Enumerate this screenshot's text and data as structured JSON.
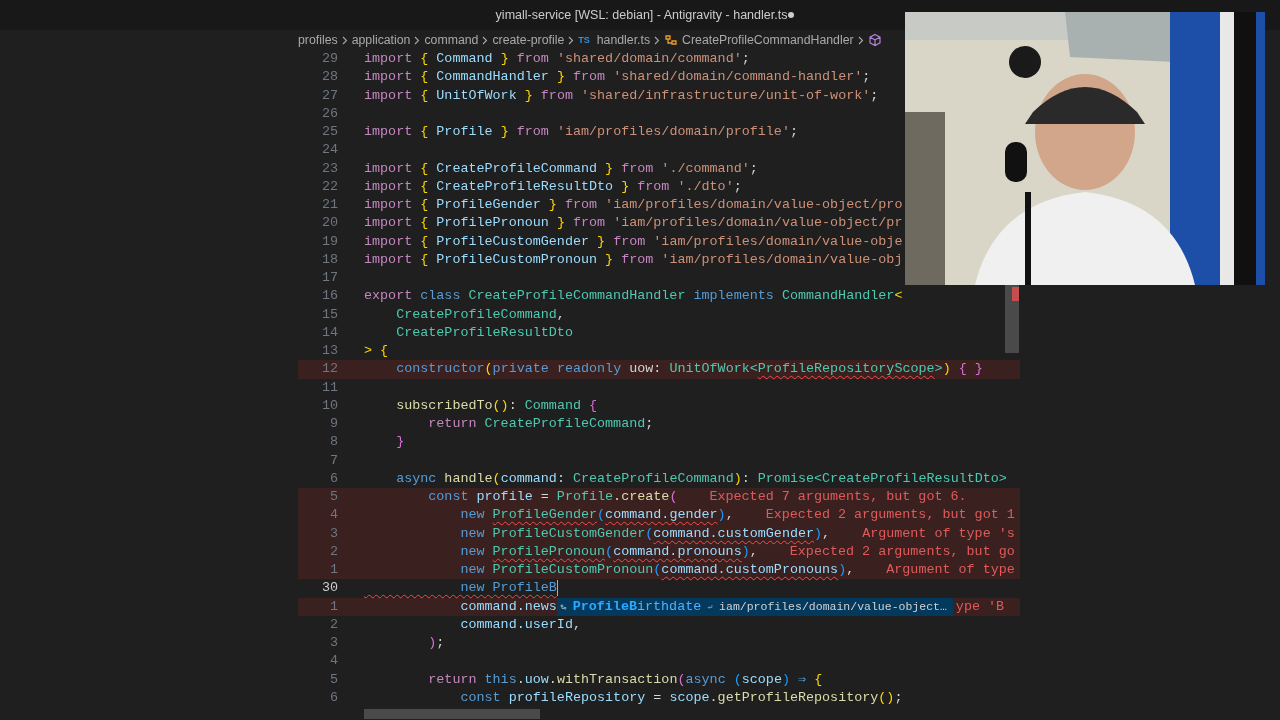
{
  "window": {
    "title": "yimall-service [WSL: debian] - Antigravity - handler.ts",
    "modified": true
  },
  "breadcrumb": [
    {
      "kind": "folder",
      "text": "profiles"
    },
    {
      "kind": "folder",
      "text": "application"
    },
    {
      "kind": "folder",
      "text": "command"
    },
    {
      "kind": "folder",
      "text": "create-profile"
    },
    {
      "kind": "file",
      "badge": "TS",
      "text": "handler.ts"
    },
    {
      "kind": "class",
      "text": "CreateProfileCommandHandler"
    },
    {
      "kind": "symbol"
    }
  ],
  "lines": [
    {
      "number": "29",
      "tokens": [
        {
          "kind": "keyword",
          "text": "import "
        },
        {
          "kind": "brace",
          "text": "{"
        },
        {
          "kind": "variable",
          "text": " Command "
        },
        {
          "kind": "brace",
          "text": "}"
        },
        {
          "kind": "keyword",
          "text": " from "
        },
        {
          "kind": "string",
          "text": "'shared/domain/command'"
        },
        {
          "kind": "plain",
          "text": ";"
        }
      ]
    },
    {
      "number": "28",
      "tokens": [
        {
          "kind": "keyword",
          "text": "import "
        },
        {
          "kind": "brace",
          "text": "{"
        },
        {
          "kind": "variable",
          "text": " CommandHandler "
        },
        {
          "kind": "brace",
          "text": "}"
        },
        {
          "kind": "keyword",
          "text": " from "
        },
        {
          "kind": "string",
          "text": "'shared/domain/command-handler'"
        },
        {
          "kind": "plain",
          "text": ";"
        }
      ]
    },
    {
      "number": "27",
      "tokens": [
        {
          "kind": "keyword",
          "text": "import "
        },
        {
          "kind": "brace",
          "text": "{"
        },
        {
          "kind": "variable",
          "text": " UnitOfWork "
        },
        {
          "kind": "brace",
          "text": "}"
        },
        {
          "kind": "keyword",
          "text": " from "
        },
        {
          "kind": "string",
          "text": "'shared/infrastructure/unit-of-work'"
        },
        {
          "kind": "plain",
          "text": ";"
        }
      ]
    },
    {
      "number": "26"
    },
    {
      "number": "25",
      "tokens": [
        {
          "kind": "keyword",
          "text": "import "
        },
        {
          "kind": "brace",
          "text": "{"
        },
        {
          "kind": "variable",
          "text": " Profile "
        },
        {
          "kind": "brace",
          "text": "}"
        },
        {
          "kind": "keyword",
          "text": " from "
        },
        {
          "kind": "string",
          "text": "'iam/profiles/domain/profile'"
        },
        {
          "kind": "plain",
          "text": ";"
        }
      ]
    },
    {
      "number": "24"
    },
    {
      "number": "23",
      "tokens": [
        {
          "kind": "keyword",
          "text": "import "
        },
        {
          "kind": "brace",
          "text": "{"
        },
        {
          "kind": "variable",
          "text": " CreateProfileCommand "
        },
        {
          "kind": "brace",
          "text": "}"
        },
        {
          "kind": "keyword",
          "text": " from "
        },
        {
          "kind": "string",
          "text": "'./command'"
        },
        {
          "kind": "plain",
          "text": ";"
        }
      ]
    },
    {
      "number": "22",
      "tokens": [
        {
          "kind": "keyword",
          "text": "import "
        },
        {
          "kind": "brace",
          "text": "{"
        },
        {
          "kind": "variable",
          "text": " CreateProfileResultDto "
        },
        {
          "kind": "brace",
          "text": "}"
        },
        {
          "kind": "keyword",
          "text": " from "
        },
        {
          "kind": "string",
          "text": "'./dto'"
        },
        {
          "kind": "plain",
          "text": ";"
        }
      ]
    },
    {
      "number": "21",
      "tokens": [
        {
          "kind": "keyword",
          "text": "import "
        },
        {
          "kind": "brace",
          "text": "{"
        },
        {
          "kind": "variable",
          "text": " ProfileGender "
        },
        {
          "kind": "brace",
          "text": "}"
        },
        {
          "kind": "keyword",
          "text": " from "
        },
        {
          "kind": "string",
          "text": "'iam/profiles/domain/value-object/pro"
        }
      ]
    },
    {
      "number": "20",
      "tokens": [
        {
          "kind": "keyword",
          "text": "import "
        },
        {
          "kind": "brace",
          "text": "{"
        },
        {
          "kind": "variable",
          "text": " ProfilePronoun "
        },
        {
          "kind": "brace",
          "text": "}"
        },
        {
          "kind": "keyword",
          "text": " from "
        },
        {
          "kind": "string",
          "text": "'iam/profiles/domain/value-object/pr"
        }
      ]
    },
    {
      "number": "19",
      "tokens": [
        {
          "kind": "keyword",
          "text": "import "
        },
        {
          "kind": "brace",
          "text": "{"
        },
        {
          "kind": "variable",
          "text": " ProfileCustomGender "
        },
        {
          "kind": "brace",
          "text": "}"
        },
        {
          "kind": "keyword",
          "text": " from "
        },
        {
          "kind": "string",
          "text": "'iam/profiles/domain/value-obje"
        }
      ]
    },
    {
      "number": "18",
      "tokens": [
        {
          "kind": "keyword",
          "text": "import "
        },
        {
          "kind": "brace",
          "text": "{"
        },
        {
          "kind": "variable",
          "text": " ProfileCustomPronoun "
        },
        {
          "kind": "brace",
          "text": "}"
        },
        {
          "kind": "keyword",
          "text": " from "
        },
        {
          "kind": "string",
          "text": "'iam/profiles/domain/value-obj"
        }
      ]
    },
    {
      "number": "17"
    },
    {
      "number": "16",
      "tokens": [
        {
          "kind": "keyword",
          "text": "export "
        },
        {
          "kind": "storage",
          "text": "class "
        },
        {
          "kind": "type",
          "text": "CreateProfileCommandHandler "
        },
        {
          "kind": "storage",
          "text": "implements "
        },
        {
          "kind": "type",
          "text": "CommandHandler"
        },
        {
          "kind": "brace",
          "text": "<"
        }
      ]
    },
    {
      "number": "15",
      "tokens": [
        {
          "kind": "type",
          "text": "    CreateProfileCommand"
        },
        {
          "kind": "plain",
          "text": ","
        }
      ]
    },
    {
      "number": "14",
      "tokens": [
        {
          "kind": "type",
          "text": "    CreateProfileResultDto"
        }
      ]
    },
    {
      "number": "13",
      "tokens": [
        {
          "kind": "brace",
          "text": "> {"
        }
      ]
    },
    {
      "number": "12",
      "error_line": true,
      "tokens": [
        {
          "kind": "storage",
          "text": "    constructor"
        },
        {
          "kind": "brace",
          "text": "("
        },
        {
          "kind": "storage",
          "text": "private readonly "
        },
        {
          "kind": "plain",
          "text": "uow: "
        },
        {
          "kind": "type",
          "text": "UnitOfWork<"
        },
        {
          "kind": "type",
          "text": "ProfileRepositoryScope",
          "squiggle": true
        },
        {
          "kind": "type",
          "text": ">"
        },
        {
          "kind": "brace",
          "text": ")"
        },
        {
          "kind": "bracket",
          "text": " { }"
        }
      ]
    },
    {
      "number": "11"
    },
    {
      "number": "10",
      "tokens": [
        {
          "kind": "function",
          "text": "    subscribedTo"
        },
        {
          "kind": "brace",
          "text": "()"
        },
        {
          "kind": "plain",
          "text": ": "
        },
        {
          "kind": "type",
          "text": "Command "
        },
        {
          "kind": "bracket",
          "text": "{"
        }
      ]
    },
    {
      "number": "9",
      "tokens": [
        {
          "kind": "keyword",
          "text": "        return "
        },
        {
          "kind": "type",
          "text": "CreateProfileCommand"
        },
        {
          "kind": "plain",
          "text": ";"
        }
      ]
    },
    {
      "number": "8",
      "tokens": [
        {
          "kind": "bracket",
          "text": "    }"
        }
      ]
    },
    {
      "number": "7"
    },
    {
      "number": "6",
      "tokens": [
        {
          "kind": "storage",
          "text": "    async "
        },
        {
          "kind": "function",
          "text": "handle"
        },
        {
          "kind": "brace",
          "text": "("
        },
        {
          "kind": "variable",
          "text": "command"
        },
        {
          "kind": "plain",
          "text": ": "
        },
        {
          "kind": "type",
          "text": "CreateProfileCommand"
        },
        {
          "kind": "brace",
          "text": ")"
        },
        {
          "kind": "plain",
          "text": ": "
        },
        {
          "kind": "type",
          "text": "Promise<CreateProfileResultDto>"
        }
      ]
    },
    {
      "number": "5",
      "error_line": true,
      "error": "Expected 7 arguments, but got 6.",
      "tokens": [
        {
          "kind": "storage",
          "text": "        const "
        },
        {
          "kind": "variable",
          "text": "profile"
        },
        {
          "kind": "plain",
          "text": " = "
        },
        {
          "kind": "type",
          "text": "Profile"
        },
        {
          "kind": "plain",
          "text": "."
        },
        {
          "kind": "function",
          "text": "create"
        },
        {
          "kind": "bracket",
          "text": "("
        }
      ]
    },
    {
      "number": "4",
      "error_line": true,
      "error": "Expected 2 arguments, but got 1",
      "tokens": [
        {
          "kind": "storage",
          "text": "            new "
        },
        {
          "kind": "type",
          "text": "ProfileGender",
          "squiggle": true
        },
        {
          "kind": "link",
          "text": "("
        },
        {
          "kind": "variable",
          "text": "command.gender",
          "squiggle": true
        },
        {
          "kind": "link",
          "text": ")"
        },
        {
          "kind": "plain",
          "text": ","
        }
      ]
    },
    {
      "number": "3",
      "error_line": true,
      "error": "Argument of type 's",
      "tokens": [
        {
          "kind": "storage",
          "text": "            new "
        },
        {
          "kind": "type",
          "text": "ProfileCustomGender"
        },
        {
          "kind": "link",
          "text": "("
        },
        {
          "kind": "variable",
          "text": "command.customGender",
          "squiggle": true
        },
        {
          "kind": "link",
          "text": ")"
        },
        {
          "kind": "plain",
          "text": ","
        }
      ]
    },
    {
      "number": "2",
      "error_line": true,
      "error": "Expected 2 arguments, but go",
      "tokens": [
        {
          "kind": "storage",
          "text": "            new "
        },
        {
          "kind": "type",
          "text": "ProfilePronoun",
          "squiggle": true
        },
        {
          "kind": "link",
          "text": "("
        },
        {
          "kind": "variable",
          "text": "command.pronouns",
          "squiggle": true
        },
        {
          "kind": "link",
          "text": ")"
        },
        {
          "kind": "plain",
          "text": ","
        }
      ]
    },
    {
      "number": "1",
      "error_line": true,
      "error": "Argument of type",
      "tokens": [
        {
          "kind": "storage",
          "text": "            new "
        },
        {
          "kind": "type",
          "text": "ProfileCustomPronoun"
        },
        {
          "kind": "link",
          "text": "("
        },
        {
          "kind": "variable",
          "text": "command.customPronouns",
          "squiggle": true
        },
        {
          "kind": "link",
          "text": ")"
        },
        {
          "kind": "plain",
          "text": ","
        }
      ]
    },
    {
      "number": "30",
      "current": true,
      "tokens": [
        {
          "kind": "storage",
          "text": "            new ProfileB",
          "squiggle": true
        }
      ]
    },
    {
      "number": "1",
      "error_line": true,
      "error": "ype 'B",
      "completion": {
        "label": "**ProfileB**irthdate",
        "detail": "iam/profiles/domain/value-object…"
      },
      "tokens": [
        {
          "kind": "variable",
          "text": "            command.news"
        }
      ]
    },
    {
      "number": "2",
      "tokens": [
        {
          "kind": "variable",
          "text": "            command.userId"
        },
        {
          "kind": "plain",
          "text": ","
        }
      ]
    },
    {
      "number": "3",
      "tokens": [
        {
          "kind": "bracket",
          "text": "        )"
        },
        {
          "kind": "plain",
          "text": ";"
        }
      ]
    },
    {
      "number": "4"
    },
    {
      "number": "5",
      "tokens": [
        {
          "kind": "keyword",
          "text": "        return "
        },
        {
          "kind": "storage",
          "text": "this"
        },
        {
          "kind": "plain",
          "text": "."
        },
        {
          "kind": "variable",
          "text": "uow"
        },
        {
          "kind": "plain",
          "text": "."
        },
        {
          "kind": "function",
          "text": "withTransaction"
        },
        {
          "kind": "bracket",
          "text": "("
        },
        {
          "kind": "storage",
          "text": "async "
        },
        {
          "kind": "link",
          "text": "("
        },
        {
          "kind": "variable",
          "text": "scope"
        },
        {
          "kind": "link",
          "text": ")"
        },
        {
          "kind": "storage",
          "text": " ⇒ "
        },
        {
          "kind": "brace",
          "text": "{"
        }
      ]
    },
    {
      "number": "6",
      "tokens": [
        {
          "kind": "storage",
          "text": "            const "
        },
        {
          "kind": "variable",
          "text": "profileRepository"
        },
        {
          "kind": "plain",
          "text": " = "
        },
        {
          "kind": "variable",
          "text": "scope"
        },
        {
          "kind": "plain",
          "text": "."
        },
        {
          "kind": "function",
          "text": "getProfileRepository"
        },
        {
          "kind": "brace",
          "text": "()"
        },
        {
          "kind": "plain",
          "text": ";"
        }
      ]
    }
  ]
}
